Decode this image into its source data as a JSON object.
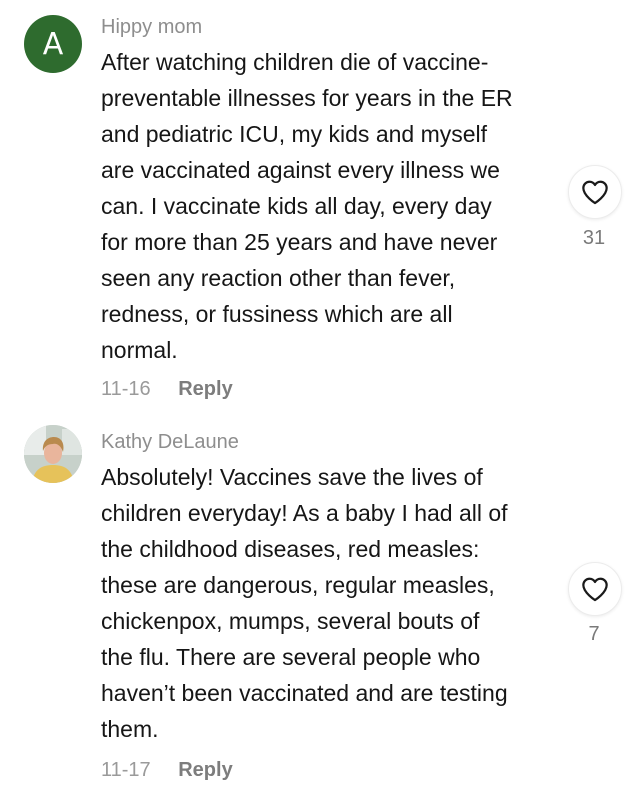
{
  "comments": [
    {
      "author": "Hippy mom",
      "avatar_letter": "A",
      "avatar_color": "#2e6b2e",
      "body_lines": [
        "After watching children die of vaccine-",
        "preventable illnesses for years in the ER",
        "and pediatric ICU, my kids and myself",
        "are vaccinated against every illness we",
        "can. I vaccinate kids all day, every day",
        "for more than 25 years and have never",
        "seen any reaction other than fever,",
        "redness, or fussiness which are all",
        "normal."
      ],
      "date": "11-16",
      "reply_label": "Reply",
      "likes": "31",
      "like_icon": "heart-outline-icon"
    },
    {
      "author": "Kathy DeLaune",
      "avatar_type": "photo",
      "body_lines": [
        "Absolutely! Vaccines save the lives of",
        "children everyday! As a baby I had all of",
        "the childhood diseases, red measles:",
        "these are dangerous, regular measles,",
        "chickenpox, mumps, several bouts of",
        "the flu. There are several people who",
        "haven’t been vaccinated and are testing",
        "them."
      ],
      "date": "11-17",
      "reply_label": "Reply",
      "likes": "7",
      "like_icon": "heart-outline-icon"
    }
  ]
}
